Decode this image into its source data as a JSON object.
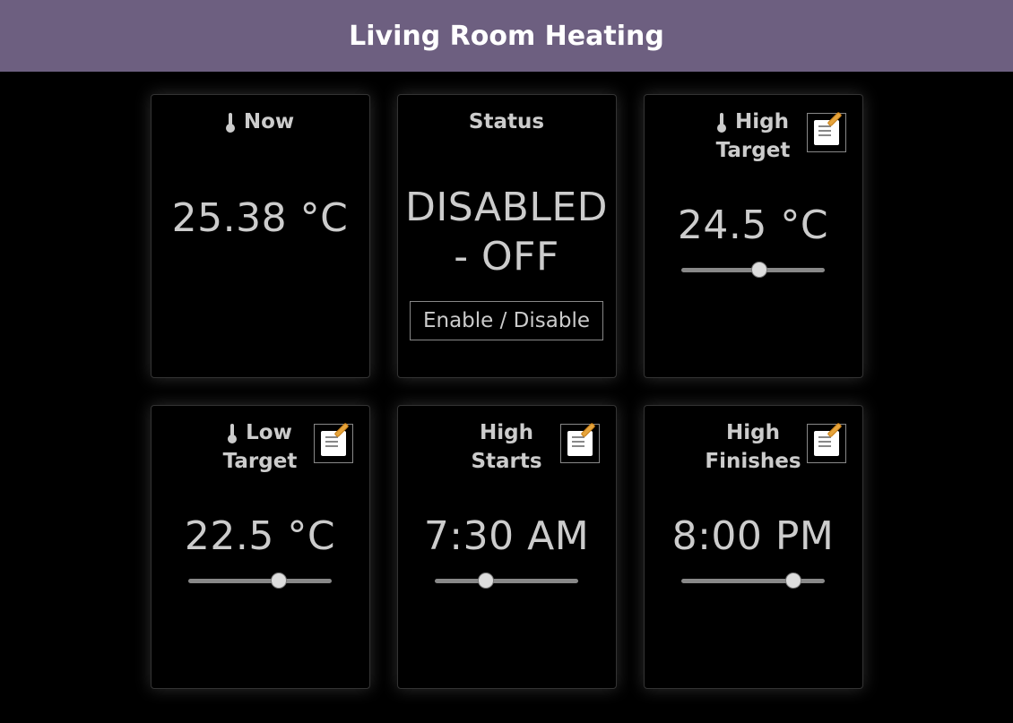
{
  "header": {
    "title": "Living Room Heating"
  },
  "cards": {
    "now": {
      "title": "Now",
      "value": "25.38 °C"
    },
    "status": {
      "title": "Status",
      "value": "DISABLED - OFF",
      "button": "Enable / Disable"
    },
    "high_target": {
      "title_l1": "High",
      "title_l2": "Target",
      "value": "24.5 °C",
      "slider": {
        "min": 0,
        "max": 100,
        "value": 55
      }
    },
    "low_target": {
      "title_l1": "Low",
      "title_l2": "Target",
      "value": "22.5 °C",
      "slider": {
        "min": 0,
        "max": 100,
        "value": 65
      }
    },
    "high_starts": {
      "title_l1": "High",
      "title_l2": "Starts",
      "value": "7:30 AM",
      "slider": {
        "min": 0,
        "max": 100,
        "value": 34
      }
    },
    "high_finishes": {
      "title_l1": "High",
      "title_l2": "Finishes",
      "value": "8:00 PM",
      "slider": {
        "min": 0,
        "max": 100,
        "value": 82
      }
    }
  }
}
